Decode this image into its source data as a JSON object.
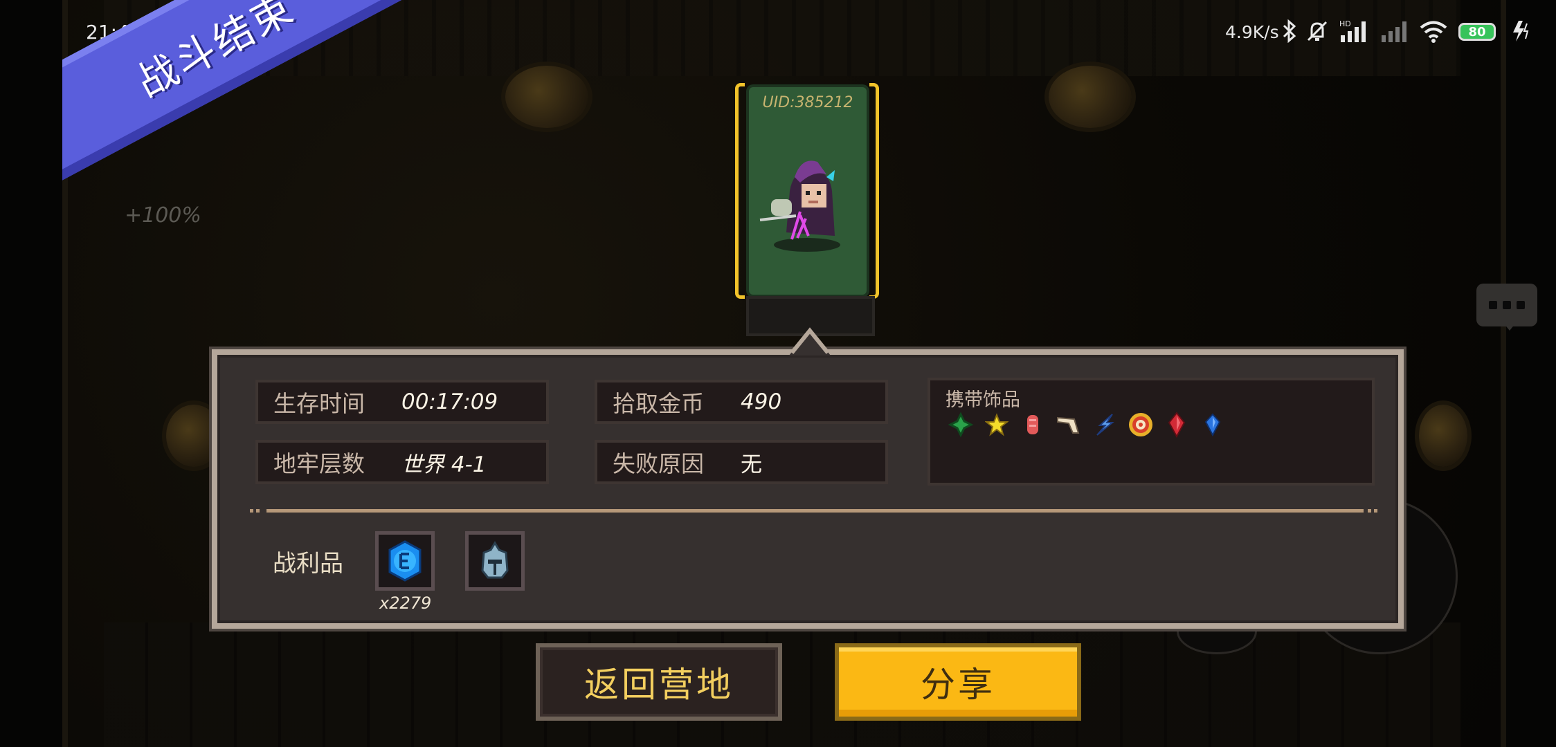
{
  "status_bar": {
    "time": "21:41",
    "net_speed": "4.9K/s",
    "battery": "80",
    "icons": [
      "bluetooth-icon",
      "mute-icon",
      "hd-signal-icon",
      "signal-icon",
      "wifi-icon",
      "charging-icon"
    ]
  },
  "banner": {
    "title": "战斗结束",
    "bonus_text": "+100%"
  },
  "character": {
    "uid": "UID:385212"
  },
  "stats": {
    "survival_time": {
      "label": "生存时间",
      "value": "00:17:09"
    },
    "gold": {
      "label": "拾取金币",
      "value": "490"
    },
    "dungeon_level": {
      "label": "地牢层数",
      "value": "世界 4-1"
    },
    "fail_reason": {
      "label": "失败原因",
      "value": "无"
    }
  },
  "accessories": {
    "title": "携带饰品",
    "items": [
      "green-clover-icon",
      "star-icon",
      "meat-icon",
      "horn-icon",
      "lightning-icon",
      "target-icon",
      "red-gem-icon",
      "blue-gem-icon"
    ]
  },
  "loot": {
    "label": "战利品",
    "items": [
      {
        "icon": "blue-coin-icon",
        "count": "x2279"
      },
      {
        "icon": "knight-helmet-icon",
        "count": ""
      }
    ]
  },
  "buttons": {
    "return_label": "返回营地",
    "share_label": "分享"
  },
  "colors": {
    "banner": "#5a5edc",
    "share_button": "#fbb814",
    "return_text": "#f3cf5f",
    "card_frame": "#f2c32a",
    "panel_border": "#b5a79a"
  }
}
